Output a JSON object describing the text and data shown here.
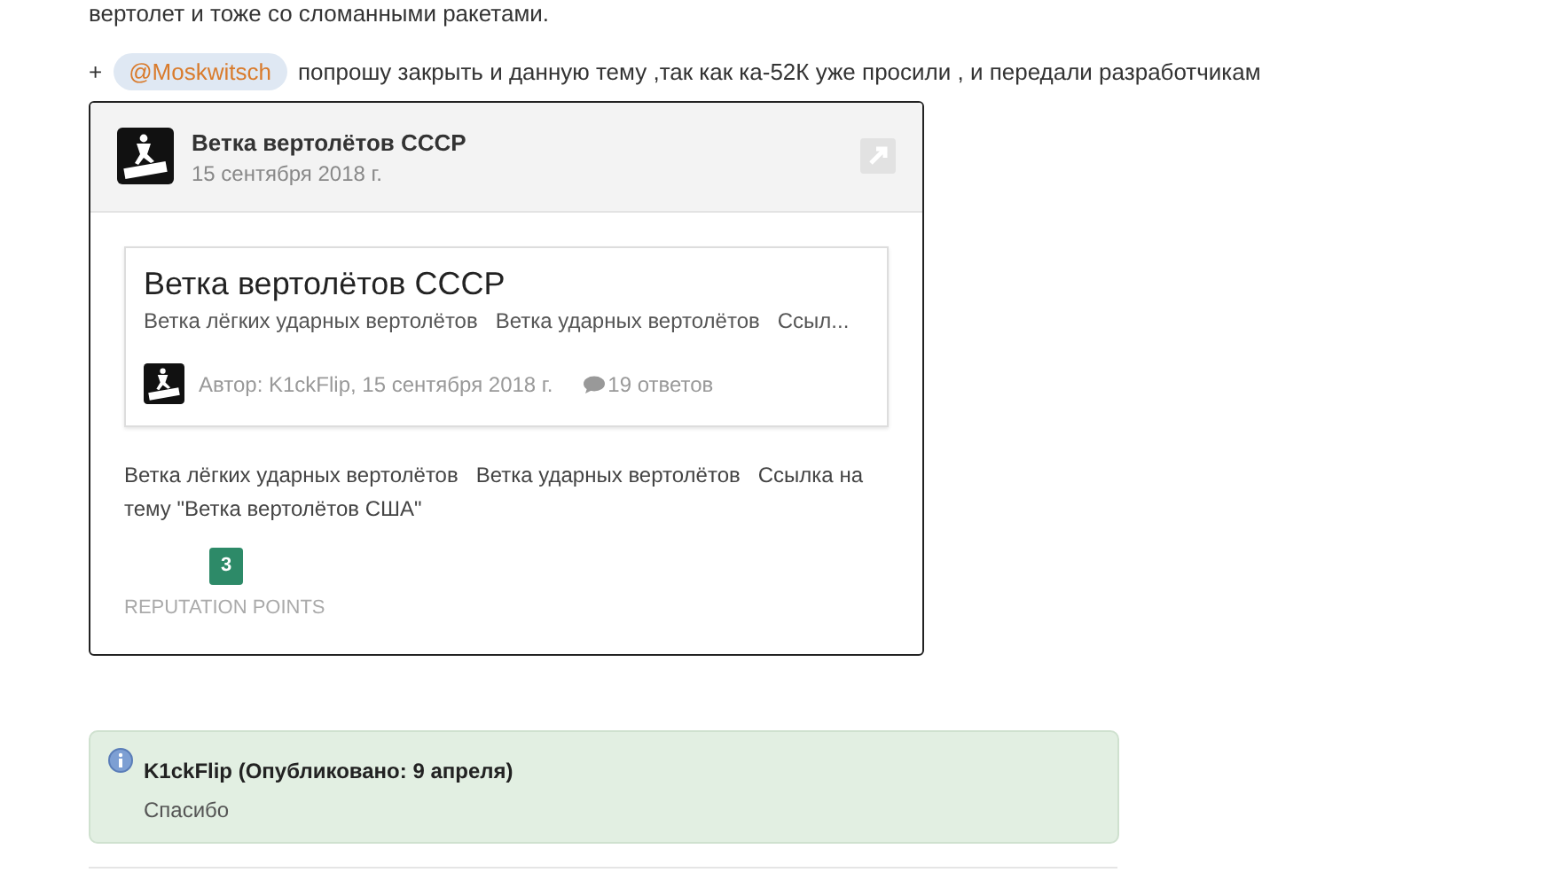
{
  "post": {
    "previous_line": "вертолет и тоже со сломанными ракетами.",
    "prefix": "+",
    "mention": "@Moskwitsch",
    "text": "попрошу закрыть и данную тему ,так как ка-52К уже просили , и передали разработчикам"
  },
  "embed": {
    "title": "Ветка вертолётов СССР",
    "date": "15 сентября 2018 г.",
    "topic": {
      "title": "Ветка вертолётов СССР",
      "snippet": "Ветка лёгких ударных вертолётов   Ветка ударных вертолётов   Ссыл...",
      "author": "Автор: K1ckFlip, 15 сентября 2018 г.",
      "replies": "19 ответов"
    },
    "body": "Ветка лёгких ударных вертолётов   Ветка ударных вертолётов   Ссылка на тему \"Ветка вертолётов США\"",
    "reputation": "3",
    "reputation_label": "REPUTATION POINTS"
  },
  "moderator_note": {
    "title": "K1ckFlip (Опубликовано: 9 апреля)",
    "text": "Спасибо"
  }
}
